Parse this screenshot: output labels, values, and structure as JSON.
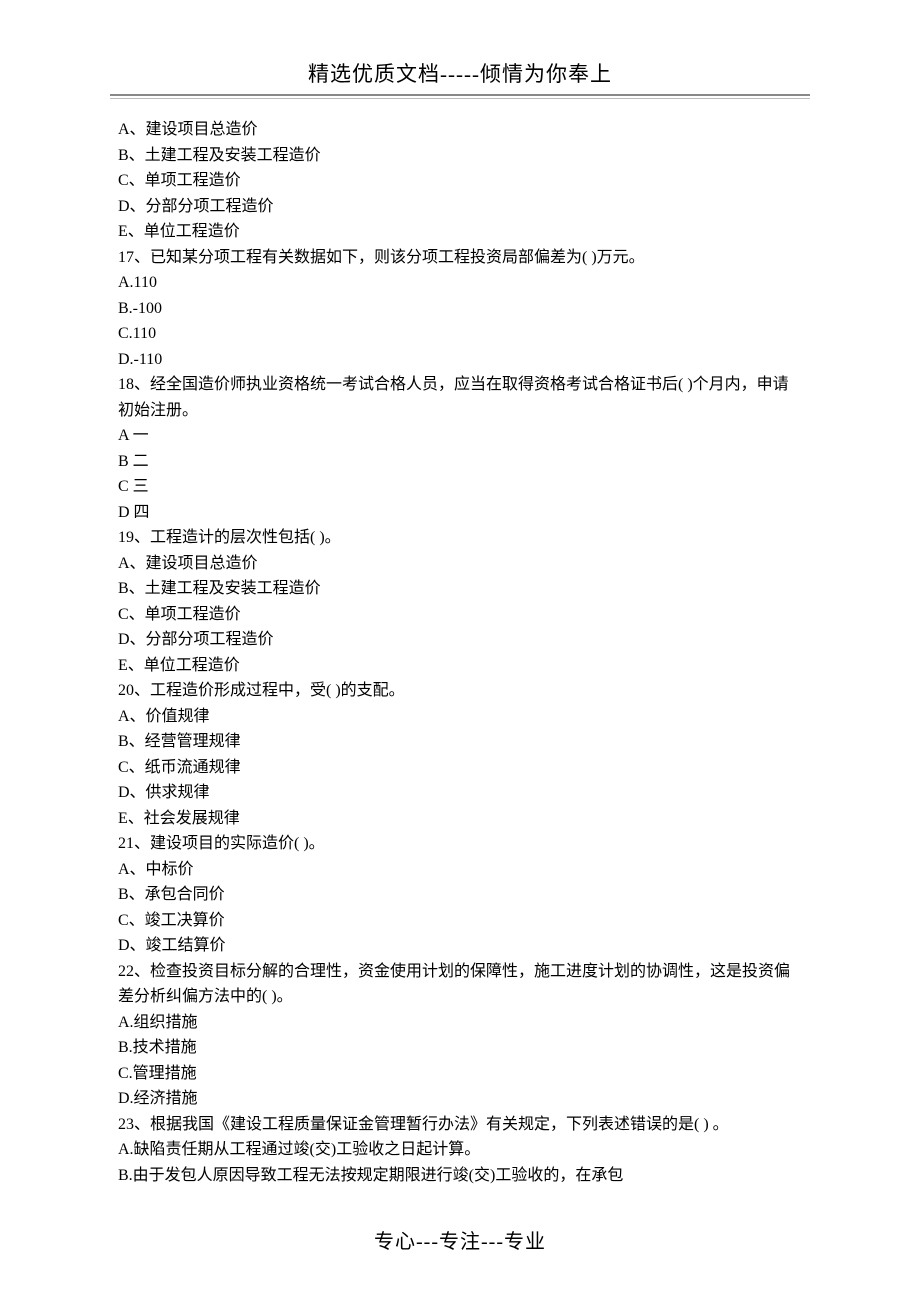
{
  "header": "精选优质文档-----倾情为你奉上",
  "footer": "专心---专注---专业",
  "lines": [
    "A、建设项目总造价",
    "B、土建工程及安装工程造价",
    "C、单项工程造价",
    "D、分部分项工程造价",
    "E、单位工程造价",
    "17、已知某分项工程有关数据如下，则该分项工程投资局部偏差为( )万元。",
    "A.110",
    "B.-100",
    "C.110",
    "D.-110",
    "18、经全国造价师执业资格统一考试合格人员，应当在取得资格考试合格证书后( )个月内，申请初始注册。",
    "A 一",
    "B 二",
    "C 三",
    "D 四",
    "19、工程造计的层次性包括( )。",
    "A、建设项目总造价",
    "B、土建工程及安装工程造价",
    "C、单项工程造价",
    "D、分部分项工程造价",
    "E、单位工程造价",
    "20、工程造价形成过程中，受( )的支配。",
    "A、价值规律",
    "B、经营管理规律",
    "C、纸币流通规律",
    "D、供求规律",
    "E、社会发展规律",
    "21、建设项目的实际造价( )。",
    "A、中标价",
    "B、承包合同价",
    "C、竣工决算价",
    "D、竣工结算价",
    "22、检查投资目标分解的合理性，资金使用计划的保障性，施工进度计划的协调性，这是投资偏差分析纠偏方法中的( )。",
    "A.组织措施",
    "B.技术措施",
    "C.管理措施",
    "D.经济措施",
    "23、根据我国《建设工程质量保证金管理暂行办法》有关规定，下列表述错误的是( ) 。",
    "A.缺陷责任期从工程通过竣(交)工验收之日起计算。",
    "B.由于发包人原因导致工程无法按规定期限进行竣(交)工验收的，在承包"
  ]
}
